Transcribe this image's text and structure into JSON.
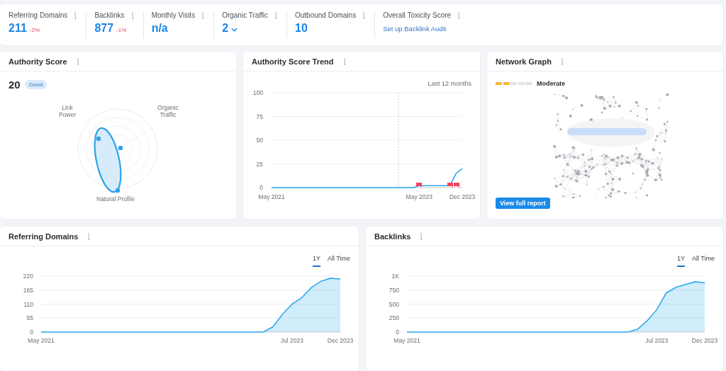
{
  "metrics": [
    {
      "label": "Referring Domains",
      "value": "211",
      "change": "-2%"
    },
    {
      "label": "Backlinks",
      "value": "877",
      "change": "-1%"
    },
    {
      "label": "Monthly Visits",
      "value": "n/a"
    },
    {
      "label": "Organic Traffic",
      "value": "2",
      "dropdown": true
    },
    {
      "label": "Outbound Domains",
      "value": "10"
    },
    {
      "label": "Overall Toxicity Score",
      "link": "Set up Backlink Audit"
    }
  ],
  "authority_score": {
    "title": "Authority Score",
    "score": "20",
    "badge": "Good",
    "radar_labels": [
      "Link Power",
      "Organic Traffic",
      "Natural Profile"
    ]
  },
  "authority_trend": {
    "title": "Authority Score Trend",
    "period": "Last 12 months",
    "chart_data": {
      "type": "line",
      "categories": [
        "May 2021",
        null,
        null,
        null,
        null,
        null,
        null,
        null,
        null,
        null,
        null,
        null,
        null,
        null,
        null,
        null,
        null,
        null,
        null,
        null,
        null,
        null,
        null,
        null,
        "May 2023",
        null,
        null,
        null,
        null,
        null,
        null,
        "Dec 2023"
      ],
      "series": [
        {
          "color": "#2fa8ee",
          "values": [
            0,
            0,
            0,
            0,
            0,
            0,
            0,
            0,
            0,
            0,
            0,
            0,
            0,
            0,
            0,
            0,
            0,
            0,
            0,
            0,
            0,
            0,
            0,
            0,
            2,
            2,
            2,
            2,
            2,
            2,
            15,
            20
          ]
        }
      ],
      "ylim": [
        0,
        100
      ],
      "yticks": [
        0,
        25,
        50,
        75,
        100
      ],
      "grid": true
    }
  },
  "network_graph": {
    "title": "Network Graph",
    "level": 0.4,
    "rating": "Moderate",
    "button": "View full report"
  },
  "growth_cards": [
    {
      "title": "Referring Domains",
      "tabs": [
        {
          "label": "1Y",
          "selected": true
        },
        {
          "label": "All Time",
          "selected": false
        }
      ],
      "chart_data": {
        "type": "area",
        "categories": [
          "May 2021",
          null,
          null,
          null,
          null,
          null,
          null,
          null,
          null,
          null,
          null,
          null,
          null,
          null,
          null,
          null,
          null,
          null,
          null,
          null,
          null,
          null,
          null,
          null,
          null,
          null,
          "Jul 2023",
          null,
          null,
          null,
          null,
          "Dec 2023"
        ],
        "series": [
          {
            "color": "#2fa8ee",
            "values": [
              0,
              0,
              0,
              0,
              0,
              0,
              0,
              0,
              0,
              0,
              0,
              0,
              0,
              0,
              0,
              0,
              0,
              0,
              0,
              0,
              0,
              0,
              0,
              0,
              20,
              70,
              110,
              135,
              175,
              200,
              212,
              208
            ]
          }
        ],
        "ylim": [
          0,
          220
        ],
        "yticks": [
          0,
          55,
          110,
          165,
          220
        ],
        "grid": true
      }
    },
    {
      "title": "Backlinks",
      "tabs": [
        {
          "label": "1Y",
          "selected": true
        },
        {
          "label": "All Time",
          "selected": false
        }
      ],
      "chart_data": {
        "type": "area",
        "categories": [
          "May 2021",
          null,
          null,
          null,
          null,
          null,
          null,
          null,
          null,
          null,
          null,
          null,
          null,
          null,
          null,
          null,
          null,
          null,
          null,
          null,
          null,
          null,
          null,
          null,
          null,
          null,
          "Jul 2023",
          null,
          null,
          null,
          null,
          "Dec 2023"
        ],
        "series": [
          {
            "color": "#2fa8ee",
            "values": [
              0,
              0,
              0,
              0,
              0,
              0,
              0,
              0,
              0,
              0,
              0,
              0,
              0,
              0,
              0,
              0,
              0,
              0,
              0,
              0,
              0,
              0,
              0,
              0,
              50,
              200,
              400,
              700,
              800,
              850,
              900,
              880
            ]
          }
        ],
        "ylim": [
          0,
          1000
        ],
        "yticks": [
          0,
          250,
          500,
          750,
          {
            "value": 1000,
            "label": "1K"
          }
        ],
        "grid": true
      }
    }
  ]
}
